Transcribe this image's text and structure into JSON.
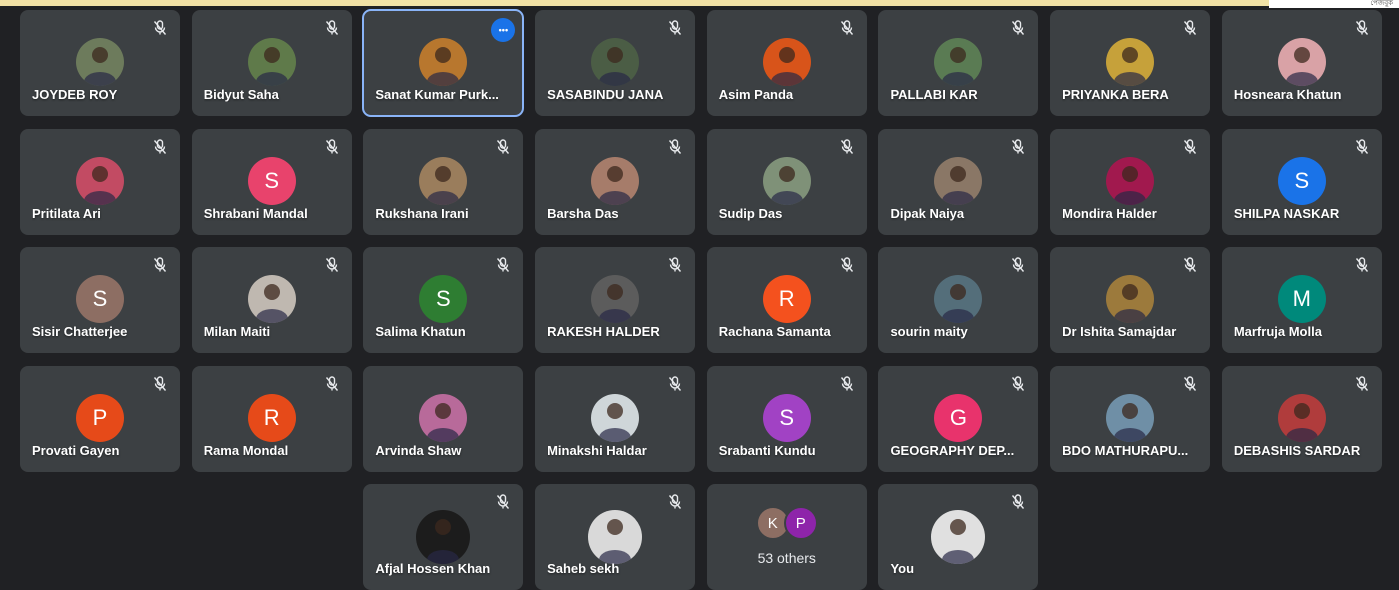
{
  "corner_text": "পেজবুক",
  "participants": [
    {
      "name": "JOYDEB ROY",
      "initial": "",
      "color": "#6d7b5c",
      "muted": true
    },
    {
      "name": "Bidyut Saha",
      "initial": "",
      "color": "#5f7a4a",
      "muted": true
    },
    {
      "name": "Sanat Kumar Purk...",
      "initial": "",
      "color": "#b8772e",
      "muted": false,
      "active": true
    },
    {
      "name": "SASABINDU JANA",
      "initial": "",
      "color": "#4b5d45",
      "muted": true
    },
    {
      "name": "Asim Panda",
      "initial": "",
      "color": "#d8541a",
      "muted": true
    },
    {
      "name": "PALLABI KAR",
      "initial": "",
      "color": "#5a7b53",
      "muted": true
    },
    {
      "name": "PRIYANKA BERA",
      "initial": "",
      "color": "#c6a13a",
      "muted": true
    },
    {
      "name": "Hosneara Khatun",
      "initial": "",
      "color": "#d9a2a6",
      "muted": true
    },
    {
      "name": "Pritilata Ari",
      "initial": "",
      "color": "#c24b63",
      "muted": true
    },
    {
      "name": "Shrabani Mandal",
      "initial": "S",
      "color": "#e8436c",
      "muted": true
    },
    {
      "name": "Rukshana Irani",
      "initial": "",
      "color": "#9a7d5c",
      "muted": true
    },
    {
      "name": "Barsha Das",
      "initial": "",
      "color": "#a67c6a",
      "muted": true
    },
    {
      "name": "Sudip Das",
      "initial": "",
      "color": "#7f9178",
      "muted": true
    },
    {
      "name": "Dipak Naiya",
      "initial": "",
      "color": "#8a7766",
      "muted": true
    },
    {
      "name": "Mondira Halder",
      "initial": "",
      "color": "#a1194e",
      "muted": true
    },
    {
      "name": "SHILPA NASKAR",
      "initial": "S",
      "color": "#1a73e8",
      "muted": true
    },
    {
      "name": "Sisir Chatterjee",
      "initial": "S",
      "color": "#8d6e63",
      "muted": true
    },
    {
      "name": "Milan Maiti",
      "initial": "",
      "color": "#bfb8b0",
      "muted": true
    },
    {
      "name": "Salima Khatun",
      "initial": "S",
      "color": "#2e7d32",
      "muted": true
    },
    {
      "name": "RAKESH HALDER",
      "initial": "",
      "color": "#5c5c5c",
      "muted": true
    },
    {
      "name": "Rachana Samanta",
      "initial": "R",
      "color": "#f4511e",
      "muted": true
    },
    {
      "name": "sourin maity",
      "initial": "",
      "color": "#546e7a",
      "muted": true
    },
    {
      "name": "Dr Ishita Samajdar",
      "initial": "",
      "color": "#9c7a3c",
      "muted": true
    },
    {
      "name": "Marfruja Molla",
      "initial": "M",
      "color": "#00897b",
      "muted": true
    },
    {
      "name": "Provati Gayen",
      "initial": "P",
      "color": "#e64a19",
      "muted": true
    },
    {
      "name": "Rama Mondal",
      "initial": "R",
      "color": "#e64a19",
      "muted": true
    },
    {
      "name": "Arvinda Shaw",
      "initial": "",
      "color": "#b86a9a",
      "muted": false
    },
    {
      "name": "Minakshi Haldar",
      "initial": "",
      "color": "#cfd6d9",
      "muted": true
    },
    {
      "name": "Srabanti Kundu",
      "initial": "S",
      "color": "#a142c4",
      "muted": true
    },
    {
      "name": "GEOGRAPHY DEP...",
      "initial": "G",
      "color": "#e8336c",
      "muted": true
    },
    {
      "name": "BDO MATHURAPU...",
      "initial": "",
      "color": "#6f8fa6",
      "muted": true
    },
    {
      "name": "DEBASHIS SARDAR",
      "initial": "",
      "color": "#b03c3c",
      "muted": true
    }
  ],
  "bottom_row": [
    {
      "name": "Afjal Hossen Khan",
      "initial": "",
      "color": "#1c1c1c",
      "muted": true
    },
    {
      "name": "Saheb sekh",
      "initial": "",
      "color": "#d9d9d9",
      "muted": true
    },
    {
      "name": "You",
      "initial": "",
      "color": "#e0e0e0",
      "muted": true
    }
  ],
  "others": {
    "count_label": "53 others",
    "avatars": [
      {
        "initial": "K",
        "color": "#8d6e63"
      },
      {
        "initial": "P",
        "color": "#8e24aa"
      }
    ]
  },
  "colors": {
    "background": "#202124",
    "tile": "#3c4043",
    "active_outline": "#8ab4f8",
    "more_button": "#1a73e8"
  },
  "icons": {
    "mic": "mic-off-icon",
    "more": "more-options-icon"
  }
}
